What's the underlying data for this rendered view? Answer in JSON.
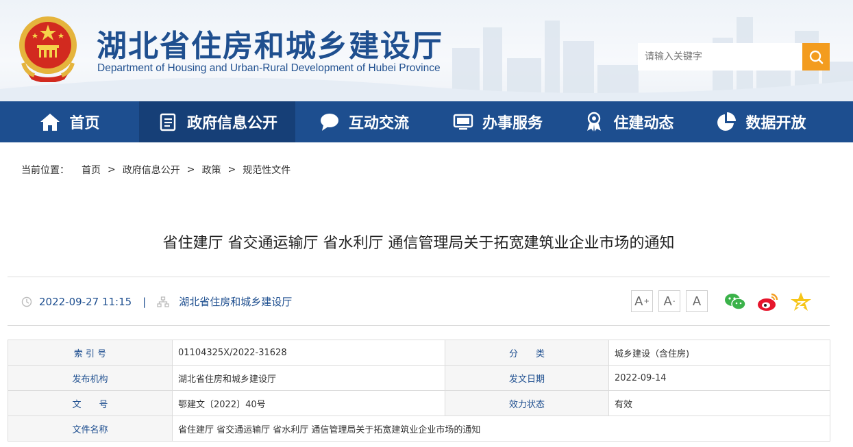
{
  "site": {
    "title": "湖北省住房和城乡建设厅",
    "subtitle": "Department of Housing and Urban-Rural Development of Hubei Province",
    "search_placeholder": "请输入关键字",
    "search_icon": "search-icon",
    "accent_color": "#1d4e8f",
    "search_button_color": "#f39c1f"
  },
  "nav": {
    "items": [
      {
        "label": "首页",
        "icon": "home-icon"
      },
      {
        "label": "政府信息公开",
        "icon": "document-list-icon",
        "active": true
      },
      {
        "label": "互动交流",
        "icon": "chat-bubble-icon"
      },
      {
        "label": "办事服务",
        "icon": "monitor-icon"
      },
      {
        "label": "住建动态",
        "icon": "award-icon"
      },
      {
        "label": "数据开放",
        "icon": "pie-chart-icon"
      }
    ]
  },
  "breadcrumb": {
    "label": "当前位置：",
    "separator": ">",
    "items": [
      "首页",
      "政府信息公开",
      "政策",
      "规范性文件"
    ]
  },
  "article": {
    "title": "省住建厅 省交通运输厅 省水利厅 通信管理局关于拓宽建筑业企业市场的通知",
    "datetime": "2022-09-27 11:15",
    "meta_separator": "|",
    "publisher": "湖北省住房和城乡建设厅",
    "font_controls": [
      "A",
      "A",
      "A"
    ],
    "share_icons": [
      "wechat-icon",
      "weibo-icon",
      "qzone-icon"
    ]
  },
  "info_table": {
    "rows": [
      {
        "k1": "索 引 号",
        "v1": "01104325X/2022-31628",
        "k2": "分　　类",
        "v2": "城乡建设（含住房)"
      },
      {
        "k1": "发布机构",
        "v1": "湖北省住房和城乡建设厅",
        "k2": "发文日期",
        "v2": "2022-09-14"
      },
      {
        "k1": "文　　号",
        "v1": "鄂建文〔2022〕40号",
        "k2": "效力状态",
        "v2": "有效"
      },
      {
        "k1": "文件名称",
        "v1": "省住建厅 省交通运输厅 省水利厅 通信管理局关于拓宽建筑业企业市场的通知"
      }
    ]
  }
}
